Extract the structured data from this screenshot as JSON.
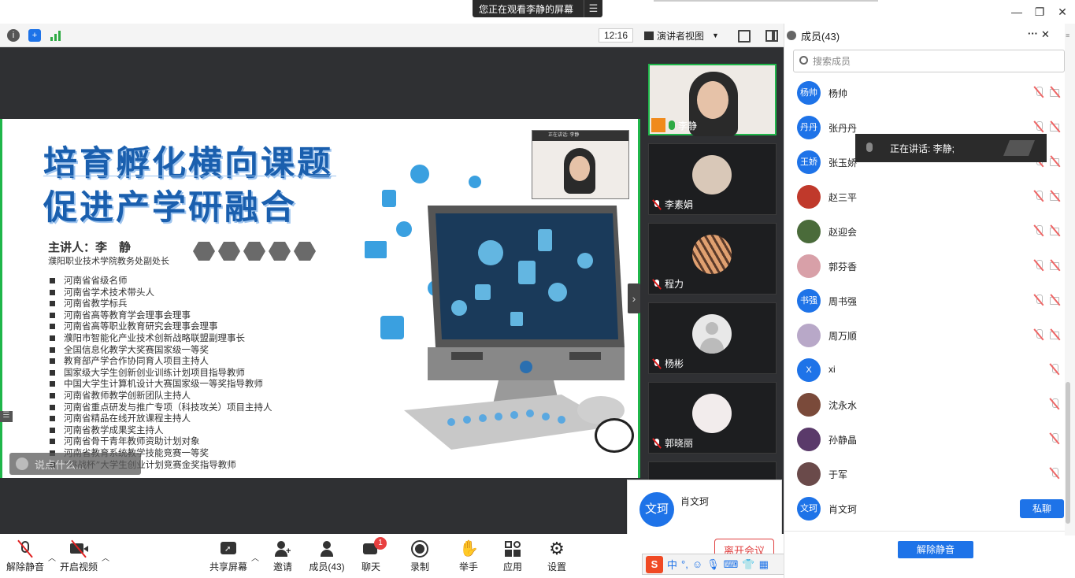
{
  "window": {
    "share_banner": "您正在观看李静的屏幕",
    "share_menu_icon": "list-icon"
  },
  "statusbar": {
    "clock": "12:16",
    "view_mode": "演讲者视图"
  },
  "slide": {
    "title_line1": "培育孵化横向课题",
    "title_line2": "促进产学研融合",
    "presenter": "主讲人：李　静",
    "presenter_org": "濮阳职业技术学院教务处副处长",
    "bullets": [
      "河南省省级名师",
      "河南省学术技术带头人",
      "河南省教学标兵",
      "河南省高等教育学会理事会理事",
      "河南省高等职业教育研究会理事会理事",
      "濮阳市智能化产业技术创新战略联盟副理事长",
      "全国信息化教学大奖赛国家级一等奖",
      "教育部产学合作协同育人项目主持人",
      "国家级大学生创新创业训练计划项目指导教师",
      "中国大学生计算机设计大赛国家级一等奖指导教师",
      "河南省教师教学创新团队主持人",
      "河南省重点研发与推广专项（科技攻关）项目主持人",
      "河南省精品在线开放课程主持人",
      "河南省教学成果奖主持人",
      "河南省骨干青年教师资助计划对象",
      "河南省教育系统教学技能竞赛一等奖",
      "“挑战杯”大学生创业计划竞赛金奖指导教师"
    ],
    "pip_label": "正在讲话: 李静",
    "comment_placeholder": "说点什么..."
  },
  "thumbnails": [
    {
      "name": "李静",
      "active": true
    },
    {
      "name": "李素娟"
    },
    {
      "name": "程力"
    },
    {
      "name": "杨彬"
    },
    {
      "name": "郭晓丽"
    }
  ],
  "popup": {
    "avatar": "文珂",
    "name": "肖文珂"
  },
  "toolbar": {
    "mute": "解除静音",
    "video": "开启视频",
    "share": "共享屏幕",
    "invite": "邀请",
    "members": "成员(43)",
    "chat": "聊天",
    "chat_badge": "1",
    "record": "录制",
    "raise_hand": "举手",
    "apps": "应用",
    "settings": "设置",
    "leave": "离开会议"
  },
  "ime": {
    "lang": "中",
    "punct": "°,"
  },
  "panel": {
    "title": "成员(43)",
    "search_placeholder": "搜索成员",
    "speaking_tooltip": "正在讲话: 李静;",
    "private_chat": "私聊",
    "unmute_all": "解除静音",
    "members": [
      {
        "avatar": "杨帅",
        "name": "杨帅",
        "color": "#1e73e8",
        "cam": true
      },
      {
        "avatar": "丹丹",
        "name": "张丹丹",
        "color": "#1e73e8",
        "cam": true
      },
      {
        "avatar": "王娇",
        "name": "张玉娇",
        "color": "#1e73e8",
        "cam": true
      },
      {
        "avatar": "",
        "name": "赵三平",
        "color": "#c0392b",
        "cam": true
      },
      {
        "avatar": "",
        "name": "赵迎会",
        "color": "#4a6b3a",
        "cam": true
      },
      {
        "avatar": "",
        "name": "郭芬香",
        "color": "#d8a0a8",
        "cam": true
      },
      {
        "avatar": "书强",
        "name": "周书强",
        "color": "#1e73e8",
        "cam": true
      },
      {
        "avatar": "",
        "name": "周万顺",
        "color": "#b8a8c8",
        "cam": true
      },
      {
        "avatar": "X",
        "name": "xi",
        "color": "#1e73e8",
        "cam": false
      },
      {
        "avatar": "",
        "name": "沈永水",
        "color": "#7a4a3a",
        "cam": false
      },
      {
        "avatar": "",
        "name": "孙静晶",
        "color": "#5a3a6a",
        "cam": false
      },
      {
        "avatar": "",
        "name": "于军",
        "color": "#6a4a4a",
        "cam": false
      },
      {
        "avatar": "文珂",
        "name": "肖文珂",
        "color": "#1e73e8",
        "cam": false
      }
    ]
  },
  "colors": {
    "accent": "#1e73e8",
    "active_border": "#1fb64a",
    "danger": "#e04040"
  }
}
